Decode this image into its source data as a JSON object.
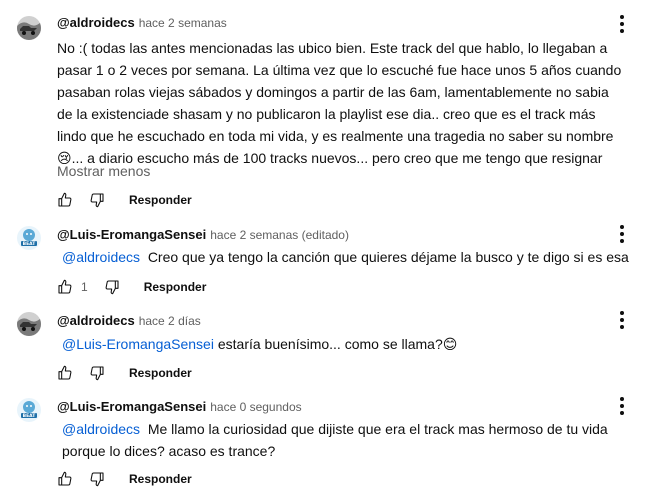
{
  "comments": [
    {
      "author": "@aldroidecs",
      "time": "hace 2 semanas",
      "text": "No :( todas las antes mencionadas las ubico bien. Este track del que hablo, lo llegaban a pasar 1 o 2 veces por semana. La última vez que lo escuché fue hace unos 5 años cuando pasaban rolas viejas sábados y domingos a partir de las 6am, lamentablemente no sabia de la existenciade shasam y no publicaron la playlist ese dia.. creo que es el track más lindo que he escuchado en toda mi vida, y es realmente una tragedia no saber su nombre",
      "emoji": "😢",
      "text_after": "... a diario escucho más de 100 tracks nuevos... pero creo que me tengo que resignar",
      "show_less": "Mostrar menos",
      "reply_label": "Responder",
      "like_count": ""
    },
    {
      "author": "@Luis-EromangaSensei",
      "time": "hace 2 semanas (editado)",
      "mention": "@aldroidecs",
      "text": "Creo que ya tengo la canción que quieres déjame la busco y te digo si es esa",
      "reply_label": "Responder",
      "like_count": "1"
    },
    {
      "author": "@aldroidecs",
      "time": "hace 2 días",
      "mention": "@Luis-EromangaSensei",
      "text": "estaría buenísimo... como se llama?",
      "emoji": "😊",
      "reply_label": "Responder",
      "like_count": ""
    },
    {
      "author": "@Luis-EromangaSensei",
      "time": "hace 0 segundos",
      "mention": "@aldroidecs",
      "text": "Me llamo la curiosidad que dijiste que era el track mas hermoso de tu vida porque lo dices? acaso es trance?",
      "reply_label": "Responder",
      "like_count": ""
    }
  ],
  "icons": {
    "like": "thumb-up-icon",
    "dislike": "thumb-down-icon",
    "menu": "more-vert-icon"
  }
}
